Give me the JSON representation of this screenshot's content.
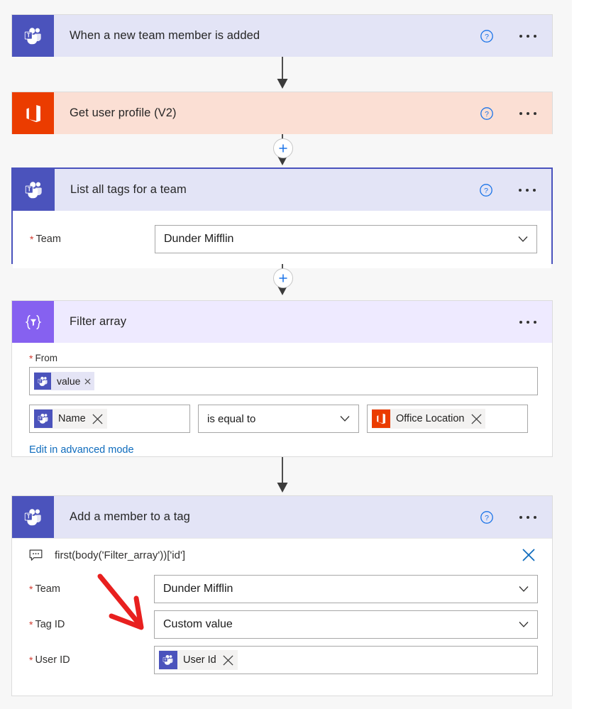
{
  "canvas": {
    "background": "#f7f7f7",
    "page_background": "#ffffff"
  },
  "colors": {
    "teams_purple": "#4b53bc",
    "teams_header": "#e3e4f6",
    "office_orange": "#eb3c00",
    "office_header": "#fbdfd4",
    "filter_purple": "#8661f0",
    "filter_header": "#eeeaff",
    "selected_border": "#4a53bd",
    "link_blue": "#0f6cbd",
    "required_red": "#d23b2f",
    "annotation_red": "#e8201f"
  },
  "steps": [
    {
      "id": "trigger",
      "title": "When a new team member is added",
      "connector": "teams",
      "icon": "teams-icon",
      "help_icon": "help-circle-icon",
      "menu_icon": "ellipsis-icon",
      "selected": false,
      "expanded": false
    },
    {
      "id": "get-user-profile",
      "title": "Get user profile (V2)",
      "connector": "office365",
      "icon": "office-365-icon",
      "help_icon": "help-circle-icon",
      "menu_icon": "ellipsis-icon",
      "selected": false,
      "expanded": false
    },
    {
      "id": "list-all-tags",
      "title": "List all tags for a team",
      "connector": "teams",
      "icon": "teams-icon",
      "help_icon": "help-circle-icon",
      "menu_icon": "ellipsis-icon",
      "selected": true,
      "expanded": true,
      "fields": [
        {
          "label": "Team",
          "required": true,
          "type": "dropdown",
          "value": "Dunder Mifflin",
          "chevron": "chevron-down-icon"
        }
      ]
    },
    {
      "id": "filter-array",
      "title": "Filter array",
      "connector": "data-operation",
      "icon": "filter-array-icon",
      "menu_icon": "ellipsis-icon",
      "selected": false,
      "expanded": true,
      "from": {
        "label": "From",
        "required": true,
        "token": {
          "text": "value",
          "icon": "teams-icon",
          "remove_icon": "remove-token-icon"
        }
      },
      "condition": {
        "left_token": {
          "text": "Name",
          "icon": "teams-icon",
          "remove_icon": "remove-token-icon"
        },
        "operator": "is equal to",
        "operator_chevron": "chevron-down-icon",
        "right_token": {
          "text": "Office Location",
          "icon": "office-365-icon",
          "remove_icon": "remove-token-icon"
        }
      },
      "advanced_link": "Edit in advanced mode"
    },
    {
      "id": "add-member-to-tag",
      "title": "Add a member to a tag",
      "connector": "teams",
      "icon": "teams-icon",
      "help_icon": "help-circle-icon",
      "menu_icon": "ellipsis-icon",
      "selected": false,
      "expanded": true,
      "expression": {
        "icon": "expression-icon",
        "text": "first(body('Filter_array'))['id']",
        "close_icon": "close-icon"
      },
      "fields": [
        {
          "label": "Team",
          "required": true,
          "type": "dropdown",
          "value": "Dunder Mifflin",
          "chevron": "chevron-down-icon"
        },
        {
          "label": "Tag ID",
          "required": true,
          "type": "dropdown",
          "value": "Custom value",
          "chevron": "chevron-down-icon"
        },
        {
          "label": "User ID",
          "required": true,
          "type": "token",
          "token": {
            "text": "User Id",
            "icon": "teams-icon",
            "remove_icon": "remove-token-icon"
          }
        }
      ]
    }
  ],
  "connectors": [
    {
      "id": "conn-1",
      "type": "arrow",
      "has_plus": false
    },
    {
      "id": "conn-2",
      "type": "arrow",
      "has_plus": true,
      "plus_icon": "add-step-icon"
    },
    {
      "id": "conn-3",
      "type": "arrow",
      "has_plus": true,
      "plus_icon": "add-step-icon"
    },
    {
      "id": "conn-4",
      "type": "arrow",
      "has_plus": false
    }
  ],
  "annotation": {
    "type": "arrow",
    "color": "#e8201f",
    "points_to": "Tag ID field"
  }
}
